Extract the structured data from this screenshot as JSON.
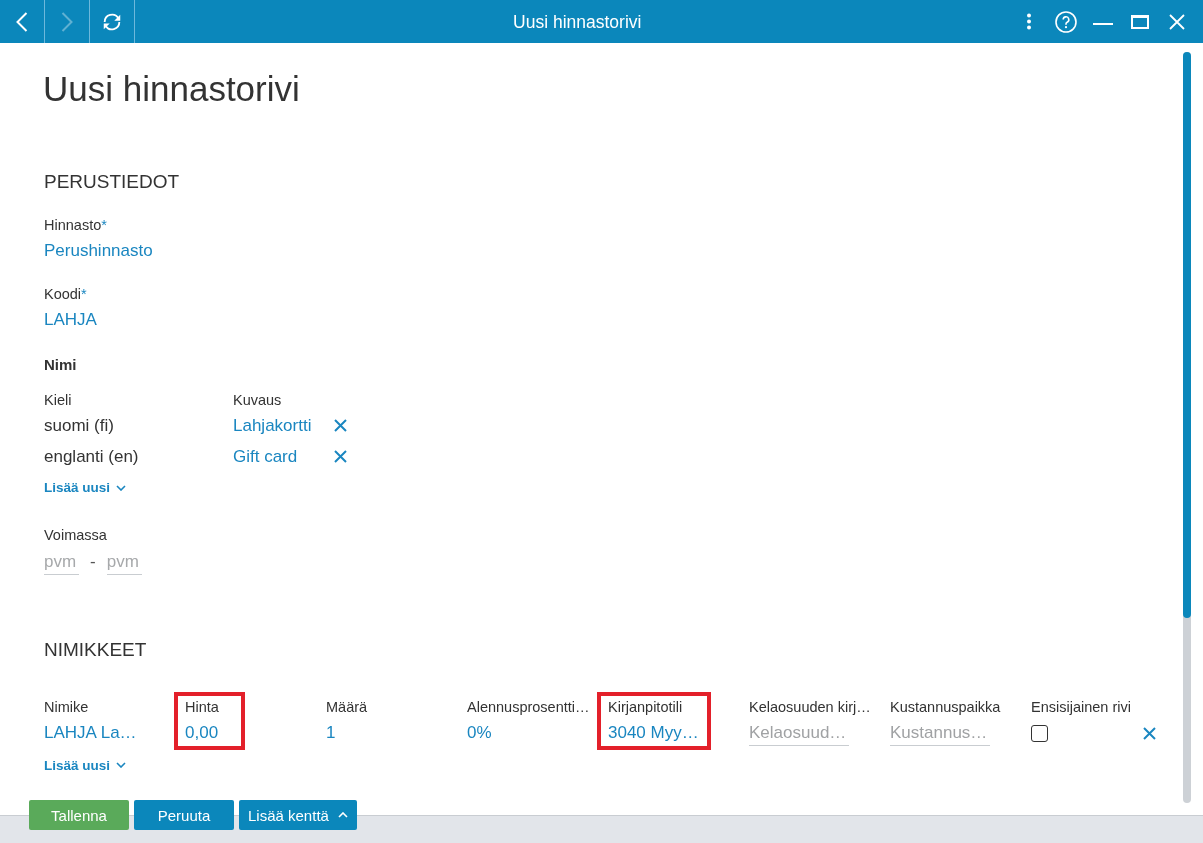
{
  "window": {
    "title": "Uusi hinnastorivi"
  },
  "nav_buttons": [
    {
      "kind": "back",
      "disabled": false
    },
    {
      "kind": "forward",
      "disabled": true
    },
    {
      "kind": "refresh",
      "disabled": false
    }
  ],
  "page": {
    "heading": "Uusi hinnastorivi"
  },
  "basic_info": {
    "heading": "PERUSTIEDOT",
    "fields": [
      {
        "label": "Hinnasto",
        "required_mark": "*",
        "value": "Perushinnasto"
      },
      {
        "label": "Koodi",
        "required_mark": "*",
        "value": "LAHJA"
      }
    ],
    "names": {
      "title": "Nimi",
      "columns": [
        "Kieli",
        "Kuvaus"
      ],
      "rows": [
        {
          "language": "suomi (fi)",
          "description": "Lahjakortti"
        },
        {
          "language": "englanti (en)",
          "description": "Gift card"
        }
      ],
      "add_link": "Lisää uusi"
    },
    "validity": {
      "label": "Voimassa",
      "from": {
        "placeholder": "pvm"
      },
      "separator": "-",
      "to": {
        "placeholder": "pvm"
      }
    }
  },
  "items": {
    "heading": "NIMIKKEET",
    "columns": [
      {
        "label": "Nimike",
        "highlighted": false
      },
      {
        "label": "Hinta",
        "highlighted": true
      },
      {
        "label": "Määrä",
        "highlighted": false
      },
      {
        "label": "Alennusprosentti…",
        "highlighted": false
      },
      {
        "label": "Kirjanpitotili",
        "highlighted": true
      },
      {
        "label": "Kelaosuuden kirj…",
        "highlighted": false
      },
      {
        "label": "Kustannuspaikka",
        "highlighted": false
      },
      {
        "label": "Ensisijainen rivi",
        "highlighted": false
      }
    ],
    "rows": [
      {
        "cells": [
          {
            "kind": "value",
            "text": "LAHJA La…"
          },
          {
            "kind": "value",
            "text": "0,00"
          },
          {
            "kind": "value",
            "text": "1"
          },
          {
            "kind": "value",
            "text": "0%"
          },
          {
            "kind": "value",
            "text": "3040 Myy…"
          },
          {
            "kind": "input",
            "placeholder": "Kelaosuud…"
          },
          {
            "kind": "input",
            "placeholder": "Kustannus…"
          },
          {
            "kind": "checkbox",
            "checked": false
          }
        ]
      }
    ],
    "add_link": "Lisää uusi"
  },
  "actions": [
    {
      "kind": "save",
      "label": "Tallenna"
    },
    {
      "kind": "cancel",
      "label": "Peruuta"
    },
    {
      "kind": "menu",
      "label": "Lisää kenttä"
    }
  ]
}
